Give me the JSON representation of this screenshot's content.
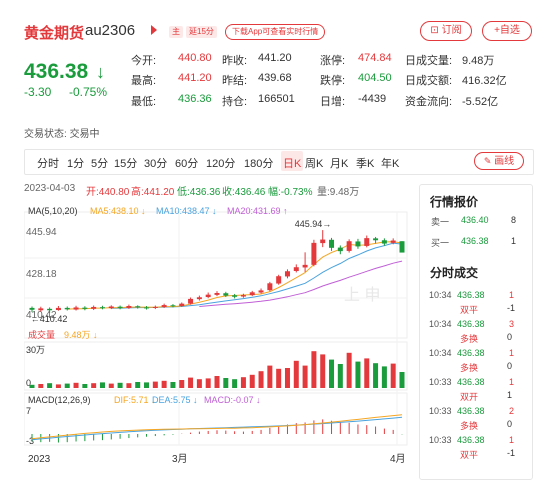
{
  "header": {
    "title": "黄金期货",
    "code": "au2306",
    "tag_main": "主",
    "tag_delay": "延15分",
    "app_link": "下载App可查看实时行情",
    "subscribe": "订阅",
    "add_watch": "+自选"
  },
  "quote": {
    "price": "436.38",
    "change": "-3.30",
    "change_pct": "-0.75%",
    "arrow": "↓",
    "status_label": "交易状态:",
    "status_value": "交易中"
  },
  "stats": [
    {
      "label": "今开:",
      "value": "440.80"
    },
    {
      "label": "昨收:",
      "value": "441.20"
    },
    {
      "label": "涨停:",
      "value": "474.84"
    },
    {
      "label": "日成交量:",
      "value": "9.48万"
    },
    {
      "label": "最高:",
      "value": "441.20"
    },
    {
      "label": "昨结:",
      "value": "439.68"
    },
    {
      "label": "跌停:",
      "value": "404.50"
    },
    {
      "label": "日成交额:",
      "value": "416.32亿"
    },
    {
      "label": "最低:",
      "value": "436.36"
    },
    {
      "label": "持仓:",
      "value": "166501"
    },
    {
      "label": "日增:",
      "value": "-4439"
    },
    {
      "label": "资金流向:",
      "value": "-5.52亿"
    }
  ],
  "tabs": [
    "分时",
    "1分",
    "5分",
    "15分",
    "30分",
    "60分",
    "120分",
    "180分",
    "日K",
    "周K",
    "月K",
    "季K",
    "年K"
  ],
  "active_tab": "日K",
  "draw_label": "画线",
  "ohlc": {
    "date": "2023-04-03",
    "open": "开:440.80",
    "high": "高:441.20",
    "low": "低:436.36",
    "close": "收:436.46",
    "amp": "幅:-0.73%",
    "vol": "量:9.48万"
  },
  "chart_data": {
    "type": "candlestick",
    "ma_label": "MA(5,10,20)",
    "ma5": "MA5:438.10 ↓",
    "ma10": "MA10:438.47 ↓",
    "ma20": "MA20:431.69 ↑",
    "y_ticks": [
      "445.94",
      "428.18",
      "410.42"
    ],
    "max_label": "445.94→",
    "min_label": "←410.42",
    "vol_label": "成交量",
    "vol_value": "9.48万 ↓",
    "vol_ticks": [
      "30万",
      "0"
    ],
    "macd_label": "MACD(12,26,9)",
    "dif": "DIF:5.71 ↓",
    "dea": "DEA:5.75 ↓",
    "macd": "MACD:-0.07 ↓",
    "macd_ticks": [
      "7",
      "-3"
    ],
    "x_labels": [
      "2023",
      "3月",
      "4月"
    ],
    "watermark": "上 申",
    "colors": {
      "up": "#e4393c",
      "down": "#1a9b3c",
      "ma5": "#f5a623",
      "ma10": "#4aa3df",
      "ma20": "#c05fd6"
    }
  },
  "orderbook": {
    "title": "行情报价",
    "rows": [
      {
        "label": "卖一",
        "price": "436.40",
        "qty": "8"
      },
      {
        "label": "买一",
        "price": "436.38",
        "qty": "1"
      }
    ]
  },
  "trades": {
    "title": "分时成交",
    "rows": [
      {
        "time": "10:34",
        "price": "436.38",
        "vol": "1",
        "type": "双平",
        "chg": "-1"
      },
      {
        "time": "10:34",
        "price": "436.38",
        "vol": "3",
        "type": "多换",
        "chg": "0"
      },
      {
        "time": "10:34",
        "price": "436.38",
        "vol": "1",
        "type": "多换",
        "chg": "0"
      },
      {
        "time": "10:33",
        "price": "436.38",
        "vol": "1",
        "type": "双开",
        "chg": "1"
      },
      {
        "time": "10:33",
        "price": "436.38",
        "vol": "2",
        "type": "多换",
        "chg": "0"
      },
      {
        "time": "10:33",
        "price": "436.38",
        "vol": "1",
        "type": "双平",
        "chg": "-1"
      }
    ]
  }
}
